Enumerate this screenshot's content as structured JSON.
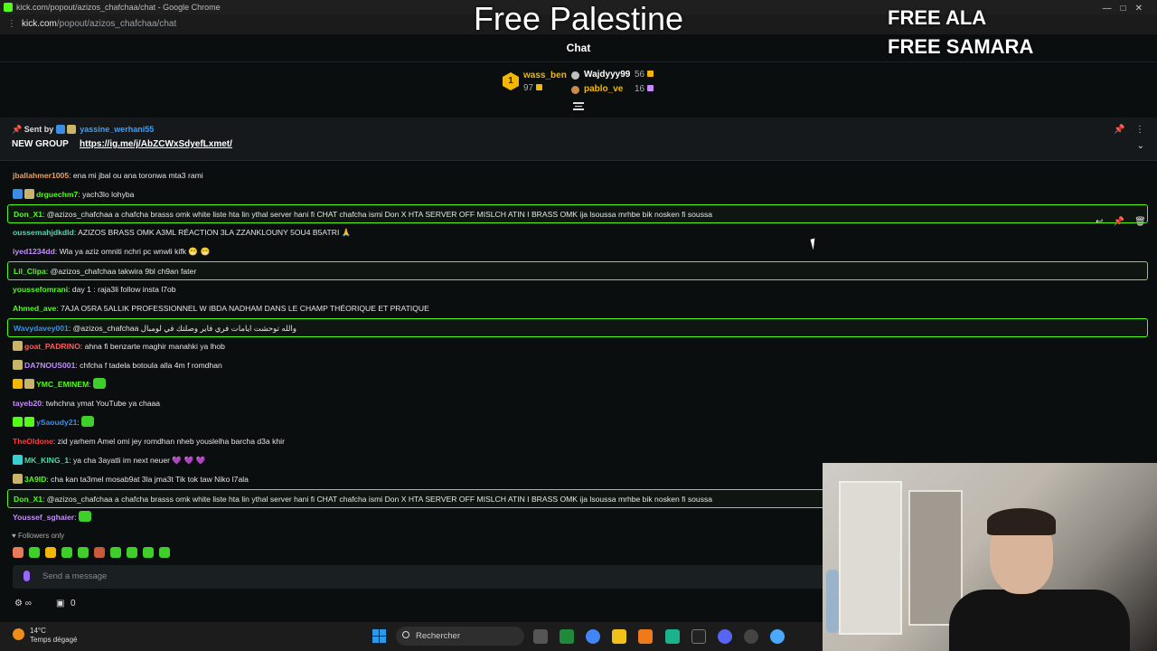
{
  "browser": {
    "window_title": "kick.com/popout/azizos_chafchaa/chat - Google Chrome",
    "url_host": "kick.com",
    "url_path": "/popout/azizos_chafchaa/chat"
  },
  "overlay": {
    "center_text": "Free Palestine",
    "right_line1": "FREE ALA",
    "right_line2": "FREE SAMARA"
  },
  "chat": {
    "header": "Chat",
    "leaderboard": [
      {
        "rank": "1",
        "name": "wass_ben",
        "count": "97"
      },
      {
        "name": "Wajdyyy99",
        "count": "56"
      },
      {
        "name": "pablo_ve",
        "count": "16"
      }
    ],
    "pinned": {
      "sent_by_label": "Sent by",
      "sender": "yassine_werhani55",
      "group_label": "NEW GROUP",
      "link": "https://ig.me/j/AbZCWxSdyefLxmet/"
    },
    "messages": [
      {
        "user": "jballahmer1005",
        "color": "#f0a05a",
        "text": "ena mi jbal ou ana toronwa mta3 rami",
        "hl": false,
        "badges": []
      },
      {
        "user": "drguechm7",
        "color": "#53fc18",
        "text": "yach3lo lohyba",
        "hl": false,
        "badges": [
          "#3a8ee6",
          "#c9b56a"
        ]
      },
      {
        "user": "Don_X1",
        "color": "#53fc18",
        "text": "@azizos_chafchaa a chafcha brasss omk white liste hta lin ythal server hani fi CHAT chafcha ismi Don X HTA SERVER OFF MISLCH ATIN I BRASS OMK ija lsoussa mrhbe bik nosken fi soussa",
        "hl": true,
        "badges": []
      },
      {
        "user": "oussemahjdkdld",
        "color": "#53d6a8",
        "text": "AZIZOS BRASS OMK A3ML RÉACTION 3LA ZZANKLOUNY 5OU4 B5ATRI 🙏",
        "hl": false,
        "badges": []
      },
      {
        "user": "iyed1234dd",
        "color": "#c58cff",
        "text": "Wla ya aziz omniti nchri pc wnwli kifk 😁 😁",
        "hl": false,
        "badges": []
      },
      {
        "user": "Lil_Clipa",
        "color": "#53fc18",
        "text": "@azizos_chafchaa takwira 9bl ch9an fater",
        "hl": true,
        "badges": []
      },
      {
        "user": "youssefomrani",
        "color": "#53fc18",
        "text": "day 1 : raja3li follow insta l7ob",
        "hl": false,
        "badges": []
      },
      {
        "user": "Ahmed_ave",
        "color": "#53fc18",
        "text": "7AJA O5RA 5ALLIK PROFESSIONNEL W IBDA NADHAM DANS LE CHAMP THÉORIQUE ET PRATIQUE",
        "hl": false,
        "badges": []
      },
      {
        "user": "Wavydavey001",
        "color": "#3a8ee6",
        "text": "@azizos_chafchaa والله توحشت ايامات فري فاير وصلتك في لومبال",
        "hl": true,
        "badges": []
      },
      {
        "user": "goat_PADRINO",
        "color": "#ff5b5b",
        "text": "ahna fi benzarte maghir manahki ya lhob",
        "hl": false,
        "badges": [
          "#c9b56a"
        ]
      },
      {
        "user": "DA7NOUS001",
        "color": "#c58cff",
        "text": "chfcha f tadela botoula alla 4m f romdhan",
        "hl": false,
        "badges": [
          "#c9b56a"
        ]
      },
      {
        "user": "YMC_EMINEM",
        "color": "#53fc18",
        "text": "",
        "hl": false,
        "badges": [
          "#f2b705",
          "#c9b56a"
        ]
      },
      {
        "user": "tayeb20",
        "color": "#c58cff",
        "text": "twhchna ymat YouTube ya chaaa",
        "hl": false,
        "badges": []
      },
      {
        "user": "ySaoudy21",
        "color": "#3a8ee6",
        "text": "",
        "hl": false,
        "badges": [
          "#53fc18",
          "#53fc18"
        ]
      },
      {
        "user": "TheOldone",
        "color": "#ff3b3b",
        "text": "zid yarhem Amel omi jey romdhan nheb youslelha barcha d3a khir",
        "hl": false,
        "badges": []
      },
      {
        "user": "MK_KING_1",
        "color": "#53d6a8",
        "text": "ya cha 3ayatli im next neuer 💜 💜 💜",
        "hl": false,
        "badges": [
          "#3ad0d0"
        ]
      },
      {
        "user": "3A9ID",
        "color": "#53fc18",
        "text": "cha kan ta3mel mosab9at 3la jma3t Tik tok taw Niko l7ala",
        "hl": false,
        "badges": [
          "#c9b56a"
        ]
      },
      {
        "user": "Don_X1",
        "color": "#53fc18",
        "text": "@azizos_chafchaa a chafcha brasss omk white liste hta lin ythal server hani fi CHAT chafcha ismi Don X HTA SERVER OFF MISLCH ATIN I BRASS OMK ija lsoussa mrhbe bik nosken fi soussa",
        "hl": true,
        "badges": []
      },
      {
        "user": "Youssef_sghaier",
        "color": "#c58cff",
        "text": "",
        "hl": false,
        "badges": []
      }
    ],
    "followers_only": "Followers only",
    "input_placeholder": "Send a message",
    "points_count": "0"
  },
  "taskbar": {
    "temperature": "14°C",
    "condition": "Temps dégagé",
    "search_placeholder": "Rechercher"
  }
}
